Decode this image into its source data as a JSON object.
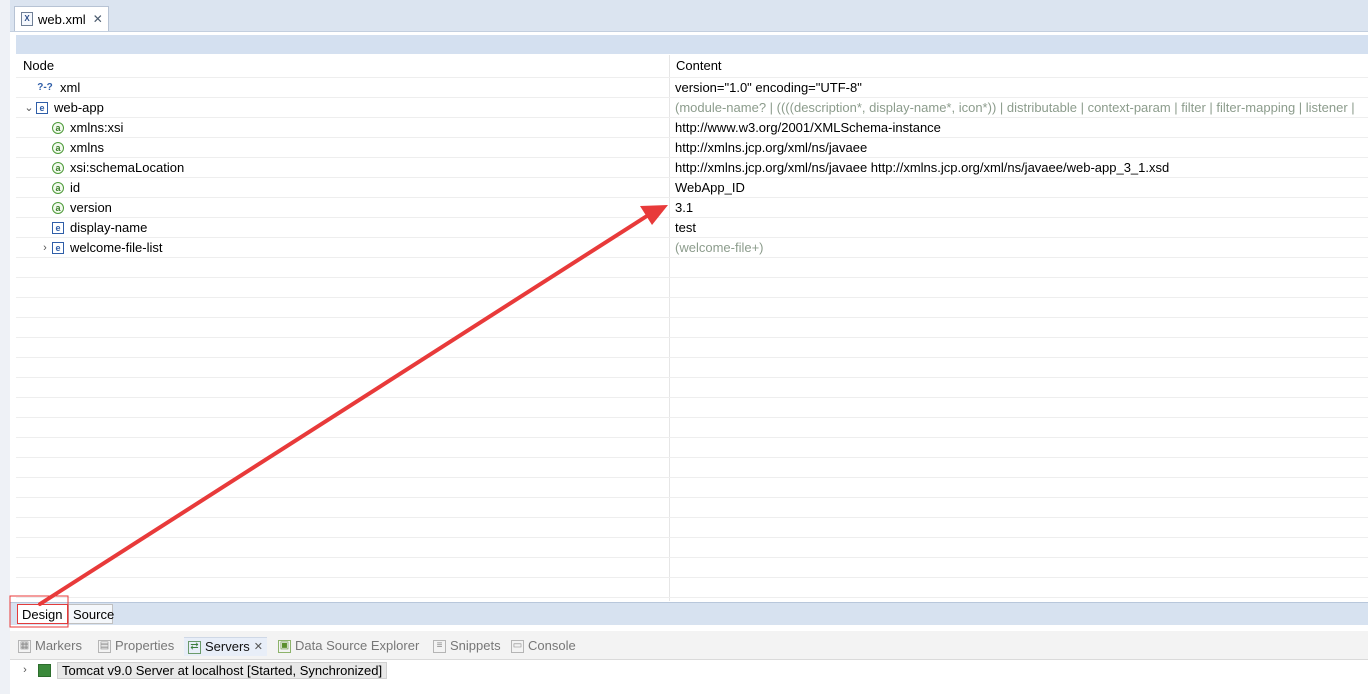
{
  "editor": {
    "tab_title": "web.xml",
    "file_icon": "X"
  },
  "tree": {
    "col_node": "Node",
    "col_content": "Content",
    "rows": [
      {
        "icon": "proc",
        "icon_text": "?-?",
        "expand": "",
        "node": "xml",
        "content": "version=\"1.0\" encoding=\"UTF-8\"",
        "muted": false
      },
      {
        "icon": "elem",
        "icon_text": "e",
        "expand": "v",
        "node": "web-app",
        "content": "(module-name? | ((((description*, display-name*, icon*)) | distributable | context-param | filter | filter-mapping | listener |",
        "muted": true
      },
      {
        "icon": "attr",
        "icon_text": "a",
        "expand": "",
        "node": "xmlns:xsi",
        "content": "http://www.w3.org/2001/XMLSchema-instance",
        "muted": false
      },
      {
        "icon": "attr",
        "icon_text": "a",
        "expand": "",
        "node": "xmlns",
        "content": "http://xmlns.jcp.org/xml/ns/javaee",
        "muted": false
      },
      {
        "icon": "attr",
        "icon_text": "a",
        "expand": "",
        "node": "xsi:schemaLocation",
        "content": "http://xmlns.jcp.org/xml/ns/javaee http://xmlns.jcp.org/xml/ns/javaee/web-app_3_1.xsd",
        "muted": false
      },
      {
        "icon": "attr",
        "icon_text": "a",
        "expand": "",
        "node": "id",
        "content": "WebApp_ID",
        "muted": false
      },
      {
        "icon": "attr",
        "icon_text": "a",
        "expand": "",
        "node": "version",
        "content": "3.1",
        "muted": false
      },
      {
        "icon": "elem",
        "icon_text": "e",
        "expand": "",
        "node": "display-name",
        "content": "test",
        "muted": false
      },
      {
        "icon": "elem",
        "icon_text": "e",
        "expand": ">",
        "node": "welcome-file-list",
        "content": "(welcome-file+)",
        "muted": true
      }
    ]
  },
  "bottom_tabs": {
    "design": "Design",
    "source": "Source"
  },
  "views": {
    "markers": "Markers",
    "properties": "Properties",
    "servers": "Servers",
    "data_source_explorer": "Data Source Explorer",
    "snippets": "Snippets",
    "console": "Console"
  },
  "server": {
    "label": "Tomcat v9.0 Server at localhost  [Started, Synchronized]"
  },
  "colors": {
    "arrow": "#e83a3a",
    "accent": "#d4e0f0"
  }
}
